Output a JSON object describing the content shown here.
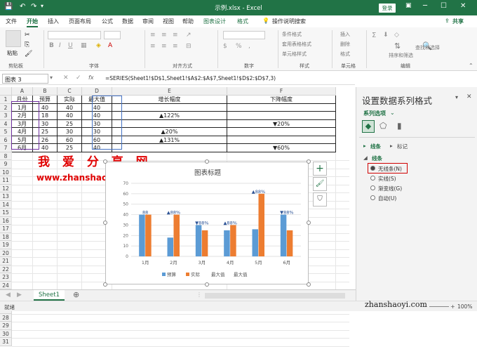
{
  "window": {
    "title": "示例.xlsx  -  Excel",
    "login": "登录"
  },
  "tabs": [
    "文件",
    "开始",
    "插入",
    "页面布局",
    "公式",
    "数据",
    "审阅",
    "视图",
    "帮助",
    "图表设计",
    "格式"
  ],
  "tell_me": "操作说明搜索",
  "share": "共享",
  "ribbon": {
    "groups": [
      "剪贴板",
      "字体",
      "对齐方式",
      "数字",
      "样式",
      "单元格",
      "编辑"
    ],
    "paste": "粘贴",
    "style_items": [
      "条件格式",
      "套用表格格式",
      "单元格样式"
    ],
    "cell_items": [
      "插入",
      "删除",
      "格式"
    ],
    "sort_filter": "排序和筛选",
    "find_select": "查找和选择"
  },
  "formula_bar": {
    "name_box": "图表 3",
    "formula": "=SERIES(Sheet1!$D$1,Sheet1!$A$2:$A$7,Sheet1!$D$2:$D$7,3)"
  },
  "grid": {
    "columns": [
      "A",
      "B",
      "C",
      "D",
      "E",
      "F"
    ],
    "rows": [
      "1",
      "2",
      "3",
      "4",
      "5",
      "6",
      "7",
      "8",
      "9",
      "10",
      "11",
      "12",
      "13",
      "14",
      "15",
      "16",
      "17",
      "18",
      "19",
      "20",
      "21",
      "22",
      "23",
      "24",
      "25",
      "26",
      "27",
      "28",
      "29",
      "30",
      "31"
    ],
    "header": [
      "月份",
      "预算",
      "实际",
      "最大值",
      "增长幅度",
      "下降幅度"
    ],
    "data": [
      [
        "1月",
        "40",
        "40",
        "40",
        "",
        ""
      ],
      [
        "2月",
        "18",
        "40",
        "40",
        "▲122%",
        ""
      ],
      [
        "3月",
        "30",
        "25",
        "30",
        "",
        "▼20%"
      ],
      [
        "4月",
        "25",
        "30",
        "30",
        "▲20%",
        ""
      ],
      [
        "5月",
        "26",
        "60",
        "60",
        "▲131%",
        ""
      ],
      [
        "6月",
        "40",
        "25",
        "40",
        "",
        "▼60%"
      ]
    ]
  },
  "watermark": {
    "line1": "我 爱 分 享 网",
    "line2": "www.zhanshaoyi.com"
  },
  "chart_data": {
    "type": "bar",
    "title": "图表标题",
    "categories": [
      "1月",
      "2月",
      "3月",
      "4月",
      "5月",
      "6月"
    ],
    "ylim": [
      0,
      70
    ],
    "yticks": [
      "0",
      "10",
      "20",
      "30",
      "40",
      "50",
      "60",
      "70"
    ],
    "series": [
      {
        "name": "预算",
        "values": [
          40,
          18,
          30,
          25,
          26,
          40
        ],
        "color": "#5b9bd5"
      },
      {
        "name": "实际",
        "values": [
          40,
          40,
          25,
          30,
          60,
          25
        ],
        "color": "#ed7d31"
      }
    ],
    "overlay_labels": [
      "88",
      "▲88%",
      "▼88%",
      "▲88%",
      "▲88%",
      "▼88%"
    ],
    "legend": [
      "预算",
      "实际",
      "最大值",
      "最大值"
    ],
    "legend_position": "bottom"
  },
  "pane": {
    "title": "设置数据系列格式",
    "series_options": "系列选项",
    "sections": [
      "线条",
      "标记"
    ],
    "line_header": "线条",
    "options": [
      "无线条(N)",
      "实线(S)",
      "渐变线(G)",
      "自动(U)"
    ],
    "selected_color": "#d00000"
  },
  "sheet": {
    "tab": "Sheet1"
  },
  "status": {
    "left": "就绪",
    "zoom": "100%",
    "watermark": "zhanshaoyi.com"
  }
}
